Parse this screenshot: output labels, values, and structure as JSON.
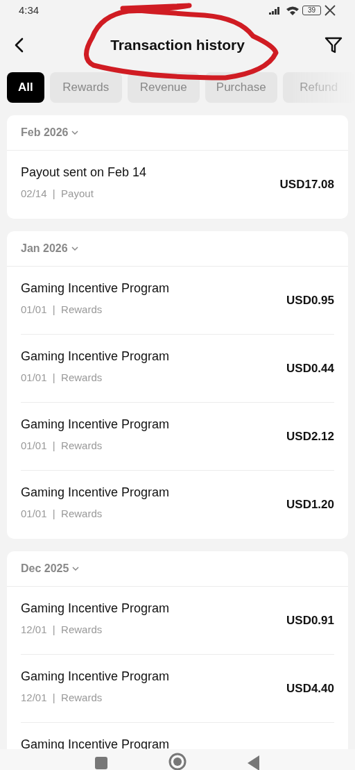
{
  "status_bar": {
    "time": "4:34",
    "battery": "39"
  },
  "header": {
    "title": "Transaction history"
  },
  "tabs": [
    {
      "label": "All",
      "selected": true
    },
    {
      "label": "Rewards",
      "selected": false
    },
    {
      "label": "Revenue",
      "selected": false
    },
    {
      "label": "Purchase",
      "selected": false
    },
    {
      "label": "Refund",
      "selected": false
    }
  ],
  "groups": [
    {
      "month": "Feb 2026",
      "rows": [
        {
          "title": "Payout sent on Feb 14",
          "meta": "02/14  |  Payout",
          "amount": "USD17.08"
        }
      ]
    },
    {
      "month": "Jan 2026",
      "rows": [
        {
          "title": "Gaming Incentive Program",
          "meta": "01/01  |  Rewards",
          "amount": "USD0.95"
        },
        {
          "title": "Gaming Incentive Program",
          "meta": "01/01  |  Rewards",
          "amount": "USD0.44"
        },
        {
          "title": "Gaming Incentive Program",
          "meta": "01/01  |  Rewards",
          "amount": "USD2.12"
        },
        {
          "title": "Gaming Incentive Program",
          "meta": "01/01  |  Rewards",
          "amount": "USD1.20"
        }
      ]
    },
    {
      "month": "Dec 2025",
      "rows": [
        {
          "title": "Gaming Incentive Program",
          "meta": "12/01  |  Rewards",
          "amount": "USD0.91"
        },
        {
          "title": "Gaming Incentive Program",
          "meta": "12/01  |  Rewards",
          "amount": "USD4.40"
        },
        {
          "title": "Gaming Incentive Program"
        }
      ]
    }
  ]
}
